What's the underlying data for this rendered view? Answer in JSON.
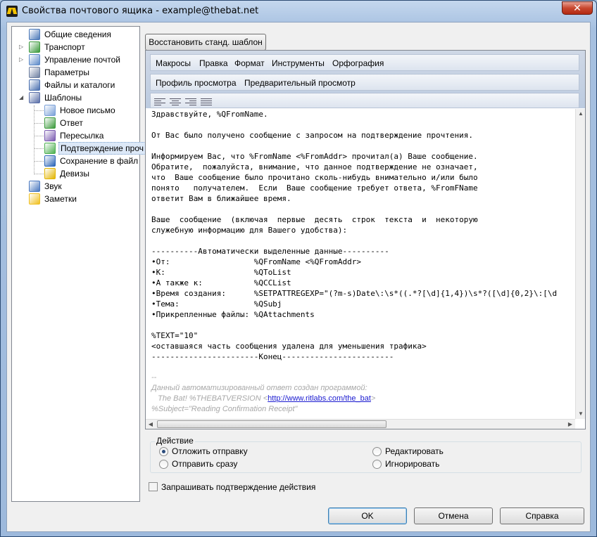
{
  "window": {
    "title": "Свойства почтового ящика - example@thebat.net",
    "close_glyph": "✕"
  },
  "tree": {
    "items": [
      {
        "label": "Общие сведения",
        "icon": "general-info-icon"
      },
      {
        "label": "Транспорт",
        "icon": "transport-icon"
      },
      {
        "label": "Управление почтой",
        "icon": "mail-management-icon"
      },
      {
        "label": "Параметры",
        "icon": "parameters-icon"
      },
      {
        "label": "Файлы и каталоги",
        "icon": "files-folders-icon"
      },
      {
        "label": "Шаблоны",
        "icon": "templates-icon"
      },
      {
        "label": "Новое письмо",
        "icon": "new-message-icon"
      },
      {
        "label": "Ответ",
        "icon": "reply-icon"
      },
      {
        "label": "Пересылка",
        "icon": "forward-icon"
      },
      {
        "label": "Подтверждение проч",
        "icon": "read-confirmation-icon"
      },
      {
        "label": "Сохранение в файл",
        "icon": "save-to-file-icon"
      },
      {
        "label": "Девизы",
        "icon": "mottos-icon"
      },
      {
        "label": "Звук",
        "icon": "sound-icon"
      },
      {
        "label": "Заметки",
        "icon": "notes-icon"
      }
    ],
    "expander_collapsed": "▷",
    "expander_expanded": "◢"
  },
  "restore_button": "Восстановить станд. шаблон",
  "menu": {
    "main": [
      "Макросы",
      "Правка",
      "Формат",
      "Инструменты",
      "Орфография"
    ],
    "view": [
      "Профиль просмотра",
      "Предварительный просмотр"
    ]
  },
  "editor": {
    "lines": [
      "Здравствуйте, %QFromName.",
      "",
      "От Вас было получено сообщение с запросом на подтверждение прочтения.",
      "",
      "Информируем Вас, что %FromName <%FromAddr> прочитал(а) Ваше сообщение.",
      "Обратите,  пожалуйста, внимание, что данное подтверждение не означает,",
      "что  Ваше сообщение было прочитано сколь-нибудь внимательно и/или было",
      "понято   получателем.  Если  Ваше сообщение требует ответа, %FromFName",
      "ответит Вам в ближайшее время.",
      "",
      "Ваше  сообщение  (включая  первые  десять  строк  текста  и  некоторую",
      "служебную информацию для Вашего удобства):",
      "",
      "----------Автоматически выделенные данные----------",
      "•От:                  %QFromName <%QFromAddr>",
      "•К:                   %QToList",
      "•А также к:           %QCCList",
      "•Время создания:      %SETPATTREGEXP=\"(?m-s)Date\\:\\s*((.*?[\\d]{1,4})\\s*?([\\d]{0,2}\\:[\\d",
      "•Тема:                %QSubj",
      "•Прикрепленные файлы: %QAttachments",
      "",
      "%TEXT=\"10\"",
      "<оставшаяся часть сообщения удалена для уменьшения трафика>",
      "-----------------------Конец------------------------",
      ""
    ],
    "signature": {
      "dashes": "--",
      "line1": "Данный автоматизированный ответ создан программой:",
      "line2_prefix": "   The Bat! %THEBATVERSION <",
      "line2_link": "http://www.ritlabs.com/the_bat",
      "line2_suffix": ">",
      "line3": "%Subject=\"Reading Confirmation Receipt\""
    }
  },
  "action_group": {
    "title": "Действие",
    "options": [
      {
        "label": "Отложить отправку",
        "checked": true
      },
      {
        "label": "Отправить сразу",
        "checked": false
      },
      {
        "label": "Редактировать",
        "checked": false
      },
      {
        "label": "Игнорировать",
        "checked": false
      }
    ]
  },
  "confirm_checkbox": {
    "label": "Запрашивать подтверждение действия",
    "checked": false
  },
  "buttons": {
    "ok": "OK",
    "cancel": "Отмена",
    "help": "Справка"
  }
}
